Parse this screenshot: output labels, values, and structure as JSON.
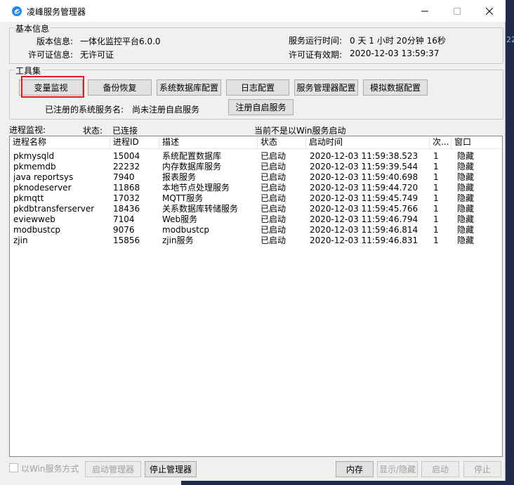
{
  "window": {
    "title": "凌峰服务管理器"
  },
  "background": {
    "edge_text": "22"
  },
  "basic_info": {
    "group_title": "基本信息",
    "version_label": "版本信息:",
    "version_value": "一体化监控平台6.0.0",
    "license_label": "许可证信息:",
    "license_value": "无许可证",
    "runtime_label": "服务运行时间:",
    "runtime_value": "0 天 1 小时 20分钟 16秒",
    "license_expiry_label": "许可证有效期:",
    "license_expiry_value": "2020-12-03 13:59:37"
  },
  "toolbar": {
    "group_title": "工具集",
    "buttons": [
      "变量监视",
      "备份恢复",
      "系统数据库配置",
      "日志配置",
      "服务管理器配置",
      "模拟数据配置"
    ],
    "registered_label": "已注册的系统服务名:",
    "registered_value": "尚未注册自启服务",
    "register_button": "注册自启服务"
  },
  "monitor": {
    "label": "进程监视:",
    "status_label": "状态:",
    "status_value": "已连接",
    "win_service_text": "当前不是以Win服务启动"
  },
  "table": {
    "columns": [
      "进程名称",
      "进程ID",
      "描述",
      "状态",
      "启动时间",
      "次...",
      "窗口"
    ],
    "rows": [
      [
        "pkmysqld",
        "15004",
        "系统配置数据库",
        "已启动",
        "2020-12-03 11:59:38.523",
        "1",
        "隐藏"
      ],
      [
        "pkmemdb",
        "22232",
        "内存数据库服务",
        "已启动",
        "2020-12-03 11:59:39.544",
        "1",
        "隐藏"
      ],
      [
        "java reportsys",
        "7940",
        "报表服务",
        "已启动",
        "2020-12-03 11:59:40.698",
        "1",
        "隐藏"
      ],
      [
        "pknodeserver",
        "11868",
        "本地节点处理服务",
        "已启动",
        "2020-12-03 11:59:44.720",
        "1",
        "隐藏"
      ],
      [
        "pkmqtt",
        "17032",
        "MQTT服务",
        "已启动",
        "2020-12-03 11:59:45.749",
        "1",
        "隐藏"
      ],
      [
        "pkdbtransferserver",
        "18436",
        "关系数据库转储服务",
        "已启动",
        "2020-12-03 11:59:45.766",
        "1",
        "隐藏"
      ],
      [
        "eviewweb",
        "7104",
        "Web服务",
        "已启动",
        "2020-12-03 11:59:46.794",
        "1",
        "隐藏"
      ],
      [
        "modbustcp",
        "9076",
        "modbustcp",
        "已启动",
        "2020-12-03 11:59:46.814",
        "1",
        "隐藏"
      ],
      [
        "zjin",
        "15856",
        "zjin服务",
        "已启动",
        "2020-12-03 11:59:46.831",
        "1",
        "隐藏"
      ]
    ]
  },
  "bottom": {
    "win_service_checkbox": "以Win服务方式",
    "start_manager": "启动管理器",
    "stop_manager": "停止管理器",
    "memory": "内存",
    "show_hide": "显示/隐藏",
    "start": "启动",
    "stop": "停止"
  }
}
